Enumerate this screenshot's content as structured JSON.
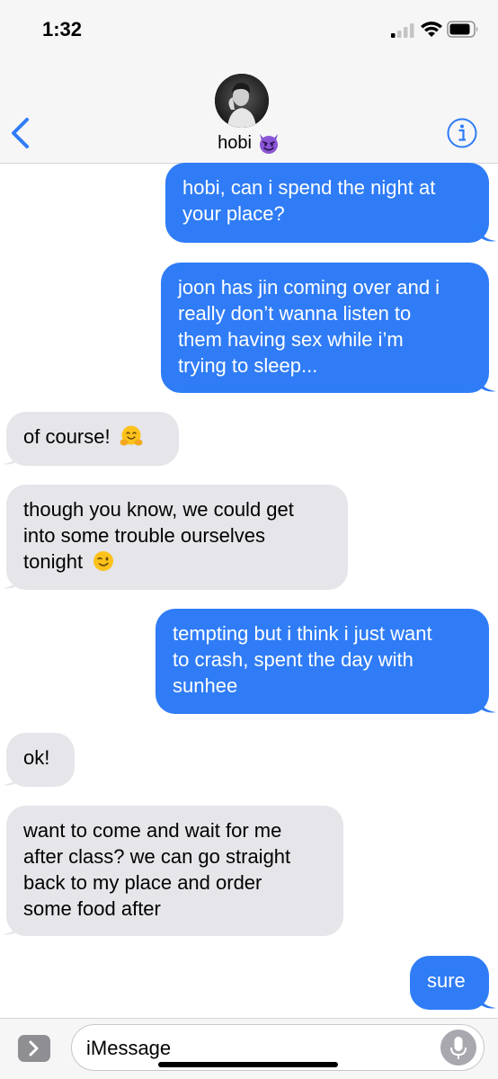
{
  "status_bar": {
    "time": "1:32"
  },
  "contact": {
    "name": "hobi",
    "name_emoji": "smiling-devil",
    "avatar": "contact-photo"
  },
  "messages": [
    {
      "direction": "outgoing",
      "text": "hobi, can i spend the night at\nyour place?"
    },
    {
      "direction": "outgoing",
      "text": "joon has jin coming over and i\nreally don’t wanna listen to\nthem having sex while i’m\ntrying to sleep..."
    },
    {
      "direction": "incoming",
      "text": "of course!",
      "emoji": "hugging-face"
    },
    {
      "direction": "incoming",
      "text": "though you know, we could get\ninto some trouble ourselves\ntonight",
      "emoji": "winking-face"
    },
    {
      "direction": "outgoing",
      "text": "tempting but i think i just want\nto crash, spent the day with\nsunhee"
    },
    {
      "direction": "incoming",
      "text": "ok!"
    },
    {
      "direction": "incoming",
      "text": "want to come and wait for me\nafter class? we can go straight\nback to my place and order\nsome food after"
    },
    {
      "direction": "outgoing",
      "text": "sure"
    }
  ],
  "composer": {
    "placeholder": "iMessage"
  },
  "colors": {
    "outgoing_bubble": "#2f7cf6",
    "incoming_bubble": "#e5e5ea",
    "accent": "#2f7cf6"
  }
}
